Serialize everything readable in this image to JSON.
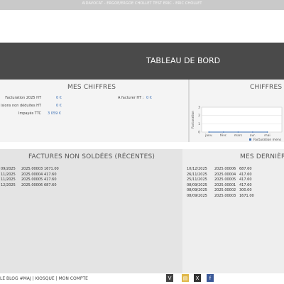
{
  "topbar": {
    "text": "AIDAVOCAT - ERGOE/ERGOE CHOLLET TEST ERIC - ERIC CHOLLET"
  },
  "header": {
    "title": "TABLEAU DE BORD"
  },
  "mes_chiffres": {
    "title": "MES CHIFFRES",
    "rows": [
      {
        "label": "Facturation 2025 HT",
        "value": "0 €"
      },
      {
        "label": "isions non déduites HT",
        "value": "0 €"
      },
      {
        "label": "Impayés TTC",
        "value": "3 059 €"
      }
    ],
    "a_facturer": {
      "label": "A facturer HT :",
      "value": "0 €"
    }
  },
  "chiffres_chart": {
    "title": "CHIFFRES",
    "ylabel": "Facturation",
    "legend": "Facturation mens"
  },
  "chart_data": {
    "type": "line",
    "title": "CHIFFRES",
    "xlabel": "",
    "ylabel": "Facturation",
    "categories": [
      "janv.",
      "févr.",
      "mars",
      "avr.",
      "mai"
    ],
    "series": [
      {
        "name": "Facturation mens",
        "values": [
          0,
          0,
          0,
          0,
          0
        ]
      }
    ],
    "yticks": [
      "0",
      "1",
      "2",
      "3"
    ],
    "ylim": [
      0,
      3
    ],
    "grid": true,
    "legend_position": "bottom"
  },
  "factures": {
    "title": "FACTURES NON SOLDÉES (RÉCENTES)",
    "rows": [
      {
        "date": "09/2025",
        "number": "2025.00003",
        "amount": "1671.00"
      },
      {
        "date": "11/2025",
        "number": "2025.00004",
        "amount": "417.60"
      },
      {
        "date": "11/2025",
        "number": "2025.00005",
        "amount": "417.60"
      },
      {
        "date": "12/2025",
        "number": "2025.00006",
        "amount": "687.60"
      }
    ]
  },
  "dernieres": {
    "title": "MES DERNIÈR",
    "rows": [
      {
        "date": "10/12/2025",
        "number": "2025.00006",
        "amount": "687.60"
      },
      {
        "date": "26/11/2025",
        "number": "2025.00004",
        "amount": "417.60"
      },
      {
        "date": "25/11/2025",
        "number": "2025.00005",
        "amount": "417.60"
      },
      {
        "date": "08/09/2025",
        "number": "2025.00001",
        "amount": "417.60"
      },
      {
        "date": "08/09/2025",
        "number": "2025.00002",
        "amount": "300.00"
      },
      {
        "date": "08/09/2025",
        "number": "2025.00003",
        "amount": "1671.00"
      }
    ]
  },
  "footer": {
    "links": "LE BLOG #MAJ | KIOSQUE | MON COMPTE",
    "icons": [
      "viadeo-icon",
      "document-icon",
      "x-icon",
      "facebook-icon"
    ],
    "icon_glyphs": [
      "V",
      "▤",
      "X",
      "f"
    ],
    "icon_colors": [
      "#444444",
      "#e0b84a",
      "#333333",
      "#3b5998"
    ]
  }
}
